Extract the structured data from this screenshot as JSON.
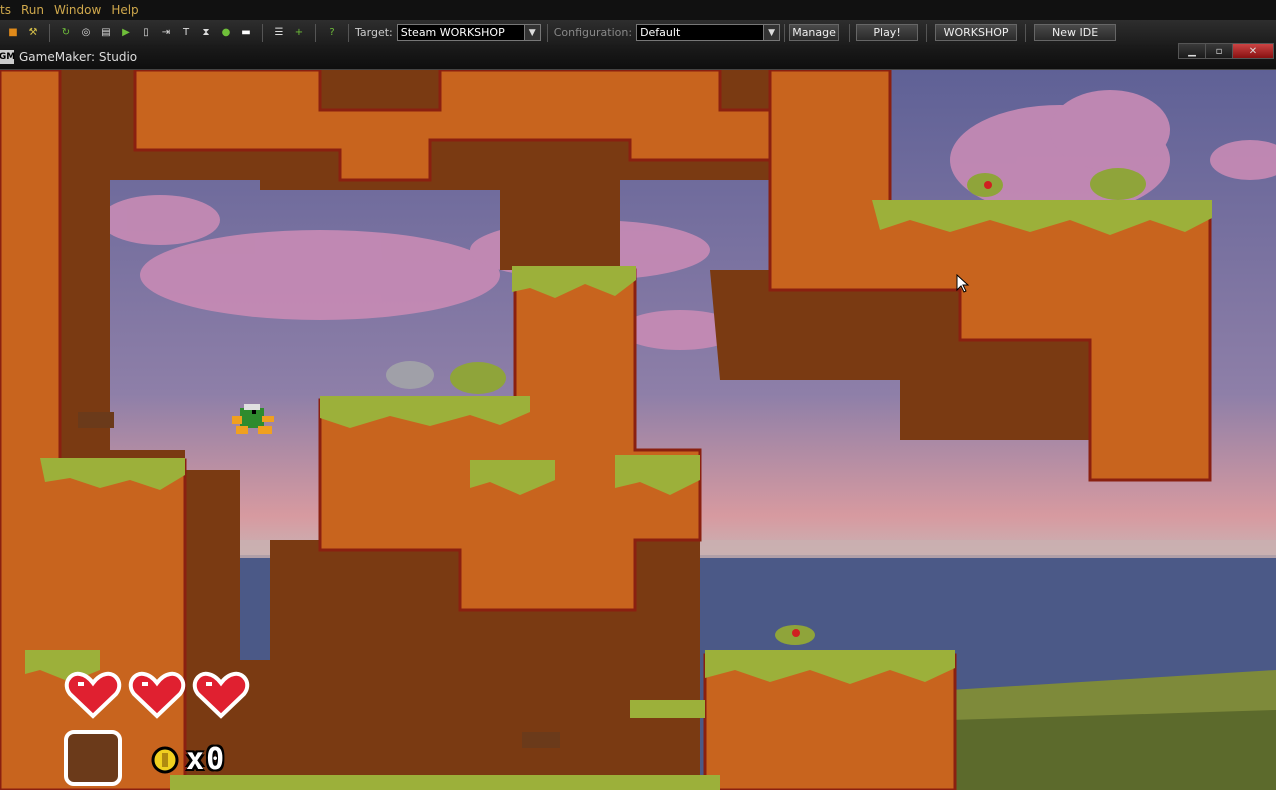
{
  "menu": {
    "items": [
      "ts",
      "Run",
      "Window",
      "Help"
    ]
  },
  "toolbar": {
    "icons": [
      "stop-icon",
      "build-icon",
      "refresh-icon",
      "target-icon",
      "image-icon",
      "play-icon",
      "run-green-icon",
      "doc-icon",
      "export-icon",
      "text-icon",
      "hourglass-icon",
      "circle-icon",
      "rect-icon",
      "list-icon",
      "plus-icon",
      "help-icon"
    ],
    "target_label": "Target:",
    "target_value": "Steam WORKSHOP",
    "config_label": "Configuration:",
    "config_value": "Default",
    "manage_label": "Manage",
    "play_label": "Play!",
    "workshop_label": "WORKSHOP",
    "new_ide_label": "New IDE"
  },
  "window": {
    "title": "GameMaker: Studio",
    "logo": "GM"
  },
  "hud": {
    "hearts": 3,
    "coin_prefix": "x",
    "coin_count": "0"
  },
  "colors": {
    "menu_text": "#cfa84c",
    "dirt": "#c8641e",
    "dirt_dark": "#7a3a12",
    "grass": "#9cb03a",
    "outline": "#8a2010",
    "sky_top": "#6e6f9c",
    "sky_pink": "#c27aa7",
    "sea": "#4c5a8c",
    "heart": "#e02030"
  }
}
